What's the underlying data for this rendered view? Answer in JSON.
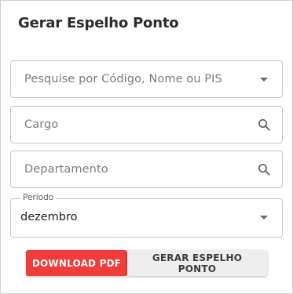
{
  "dialog": {
    "title": "Gerar Espelho Ponto"
  },
  "fields": {
    "employee_search": {
      "placeholder": "Pesquise por Código, Nome ou PIS",
      "icon": "chevron-down-icon"
    },
    "cargo": {
      "placeholder": "Cargo",
      "icon": "search-icon"
    },
    "departamento": {
      "placeholder": "Departamento",
      "icon": "search-icon"
    },
    "periodo": {
      "label": "Período",
      "value": "dezembro",
      "icon": "chevron-down-icon"
    }
  },
  "buttons": {
    "download_pdf": "DOWNLOAD PDF",
    "gerar_espelho": "GERAR ESPELHO PONTO"
  },
  "colors": {
    "primary_red": "#f03c3a",
    "secondary_gray": "#eeeeee",
    "border": "#c4c4c4"
  }
}
